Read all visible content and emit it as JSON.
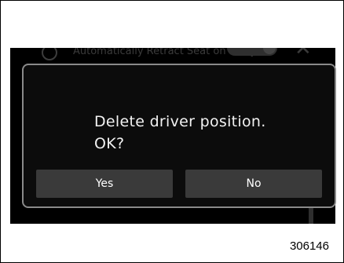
{
  "background": {
    "setting_label": "Automatically Retract Seat on Entry",
    "info_icon": "info-icon",
    "toggle_icon": "toggle-switch",
    "close_icon": "close-icon"
  },
  "dialog": {
    "message_line1": "Delete driver position.",
    "message_line2": "OK?",
    "yes_label": "Yes",
    "no_label": "No"
  },
  "figure_ref": "306146",
  "colors": {
    "screen_bg": "#000000",
    "dialog_border": "#8a8a8a",
    "button_bg": "#3a3a3a",
    "text": "#ffffff"
  }
}
